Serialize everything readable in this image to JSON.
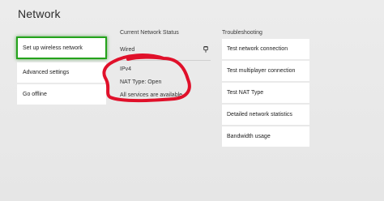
{
  "page": {
    "title": "Network"
  },
  "menu": {
    "items": [
      {
        "label": "Set up wireless network"
      },
      {
        "label": "Advanced settings"
      },
      {
        "label": "Go offline"
      }
    ]
  },
  "status": {
    "header": "Current Network Status",
    "connection": "Wired",
    "connection_icon": "wired-plug-icon",
    "ip_version": "IPv4",
    "nat_type": "NAT Type: Open",
    "services": "All services are available"
  },
  "troubleshooting": {
    "header": "Troubleshooting",
    "items": [
      {
        "label": "Test network connection"
      },
      {
        "label": "Test multiplayer connection"
      },
      {
        "label": "Test NAT Type"
      },
      {
        "label": "Detailed network statistics"
      },
      {
        "label": "Bandwidth usage"
      }
    ]
  },
  "colors": {
    "background": "#e9e9e9",
    "tile": "#ffffff",
    "focus_highlight": "#24a31c",
    "annotation": "#e0102a"
  }
}
